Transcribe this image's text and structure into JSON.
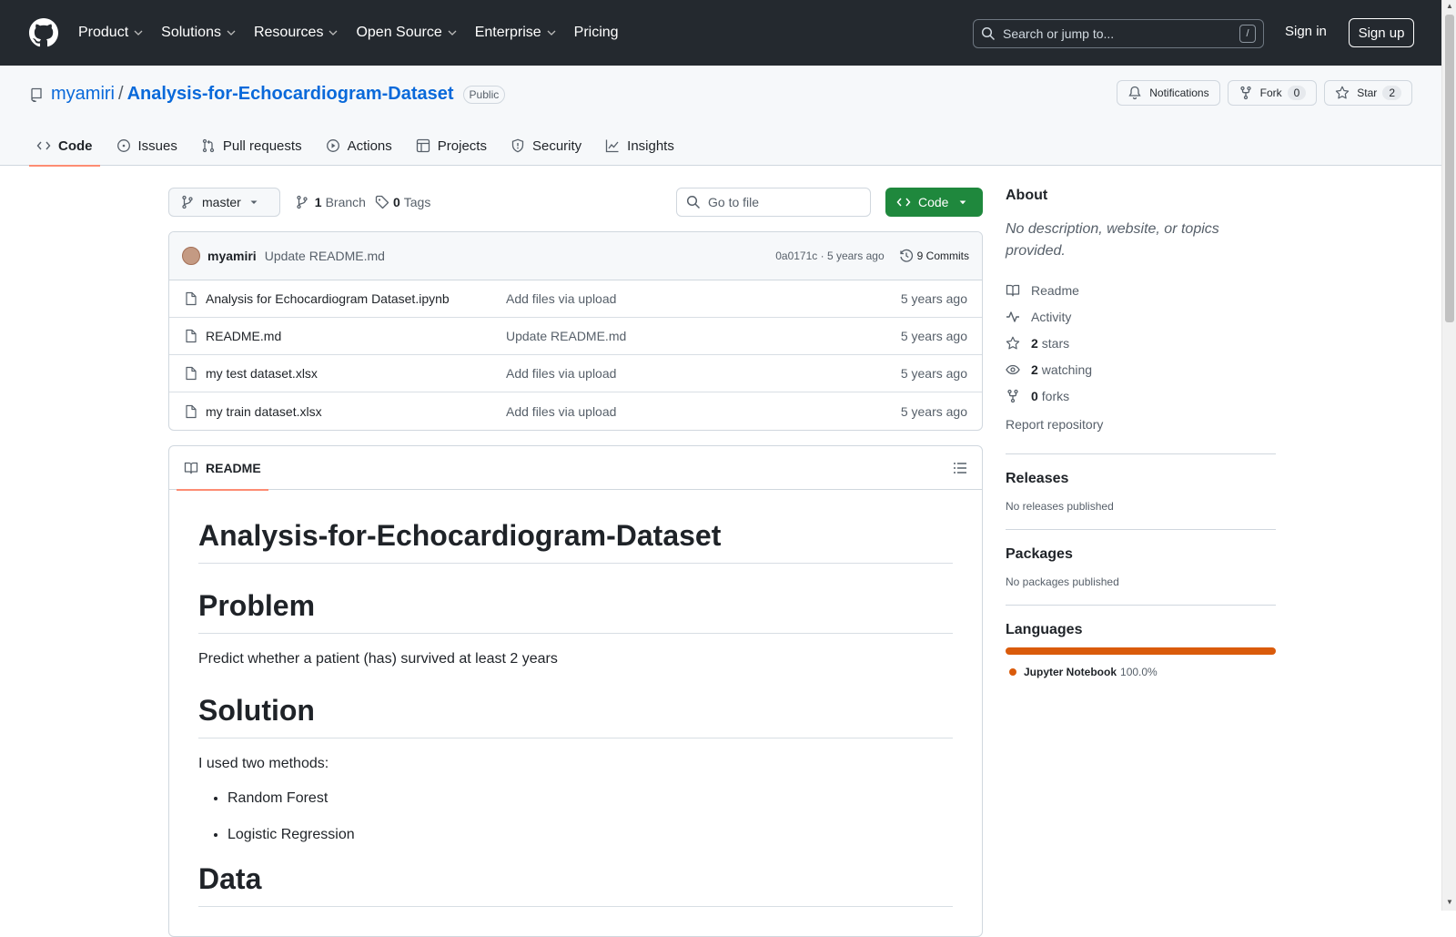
{
  "topnav": {
    "items": [
      "Product",
      "Solutions",
      "Resources",
      "Open Source",
      "Enterprise",
      "Pricing"
    ],
    "search_placeholder": "Search or jump to...",
    "search_shortcut": "/",
    "signin": "Sign in",
    "signup": "Sign up"
  },
  "repo": {
    "owner": "myamiri",
    "separator": "/",
    "name": "Analysis-for-Echocardiogram-Dataset",
    "visibility": "Public",
    "notifications_label": "Notifications",
    "fork_label": "Fork",
    "fork_count": "0",
    "star_label": "Star",
    "star_count": "2"
  },
  "tabs": [
    "Code",
    "Issues",
    "Pull requests",
    "Actions",
    "Projects",
    "Security",
    "Insights"
  ],
  "toolbar": {
    "branch": "master",
    "branch_count": "1",
    "branch_label": "Branch",
    "tag_count": "0",
    "tag_label": "Tags",
    "goto_file_placeholder": "Go to file",
    "code_button": "Code"
  },
  "commit": {
    "author": "myamiri",
    "message": "Update README.md",
    "meta": "0a0171c · 5 years ago",
    "commits_label": "9 Commits"
  },
  "files": [
    {
      "name": "Analysis for Echocardiogram Dataset.ipynb",
      "message": "Add files via upload",
      "time": "5 years ago"
    },
    {
      "name": "README.md",
      "message": "Update README.md",
      "time": "5 years ago"
    },
    {
      "name": "my test dataset.xlsx",
      "message": "Add files via upload",
      "time": "5 years ago"
    },
    {
      "name": "my train dataset.xlsx",
      "message": "Add files via upload",
      "time": "5 years ago"
    }
  ],
  "readme": {
    "tab_label": "README",
    "title": "Analysis-for-Echocardiogram-Dataset",
    "problem_heading": "Problem",
    "problem_text": "Predict whether a patient (has) survived at least 2 years",
    "solution_heading": "Solution",
    "solution_text": "I used two methods:",
    "methods": [
      "Random Forest",
      "Logistic Regression"
    ],
    "data_heading": "Data"
  },
  "about": {
    "heading": "About",
    "description": "No description, website, or topics provided.",
    "readme": "Readme",
    "activity": "Activity",
    "stars_count": "2",
    "stars_label": "stars",
    "watching_count": "2",
    "watching_label": "watching",
    "forks_count": "0",
    "forks_label": "forks",
    "report": "Report repository"
  },
  "releases": {
    "heading": "Releases",
    "text": "No releases published"
  },
  "packages": {
    "heading": "Packages",
    "text": "No packages published"
  },
  "languages": {
    "heading": "Languages",
    "name": "Jupyter Notebook",
    "percent": "100.0%",
    "color": "#DA5B0B"
  }
}
